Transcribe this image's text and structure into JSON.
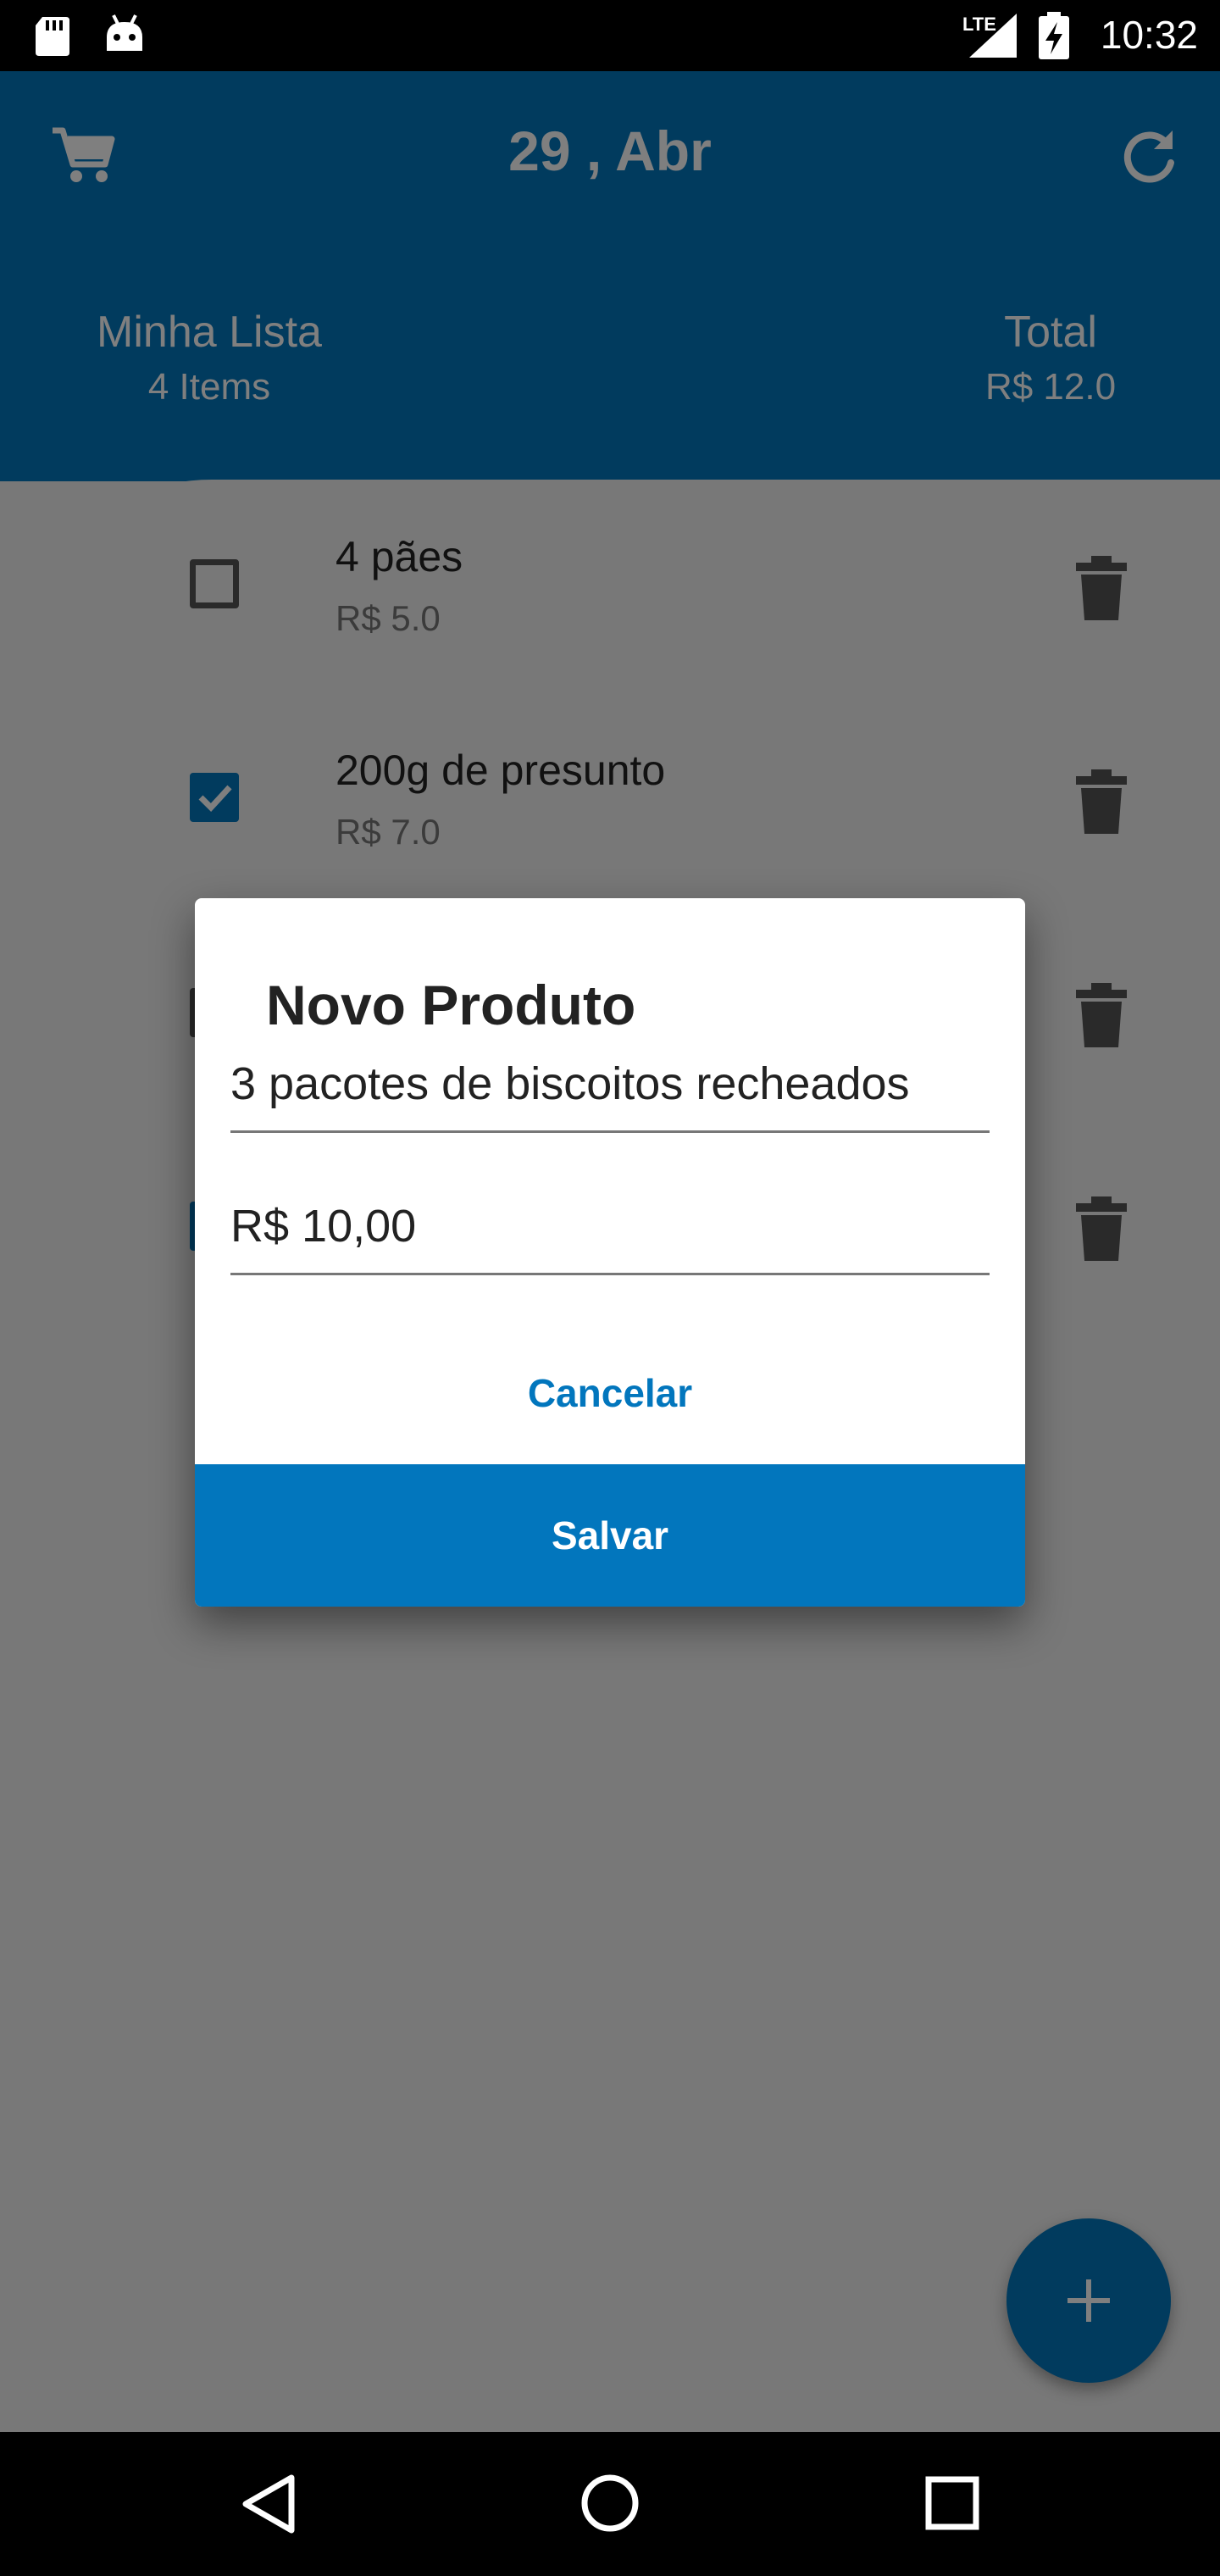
{
  "status_bar": {
    "time": "10:32",
    "network_label": "LTE",
    "icons": [
      "sd-card-icon",
      "android-icon",
      "signal-icon",
      "battery-charging-icon"
    ]
  },
  "header": {
    "date": "29 , Abr",
    "cart_icon": "cart-icon",
    "refresh_icon": "refresh-icon",
    "list_title": "Minha Lista",
    "list_count": "4 Items",
    "total_title": "Total",
    "total_value": "R$ 12.0"
  },
  "items": [
    {
      "name": "4 pães",
      "price": "R$ 5.0",
      "checked": false
    },
    {
      "name": "200g de presunto",
      "price": "R$ 7.0",
      "checked": true
    },
    {
      "name": "",
      "price": "",
      "checked": false
    },
    {
      "name": "",
      "price": "",
      "checked": true
    }
  ],
  "dialog": {
    "title": "Novo Produto",
    "name_value": "3 pacotes de biscoitos recheados",
    "price_value": "R$ 10,00",
    "cancel_label": "Cancelar",
    "save_label": "Salvar"
  },
  "fab_icon": "plus-icon",
  "nav_bar": {
    "icons": [
      "back-icon",
      "home-icon",
      "recents-icon"
    ]
  },
  "colors": {
    "primary": "#0276bd",
    "scrim": "#000000"
  }
}
